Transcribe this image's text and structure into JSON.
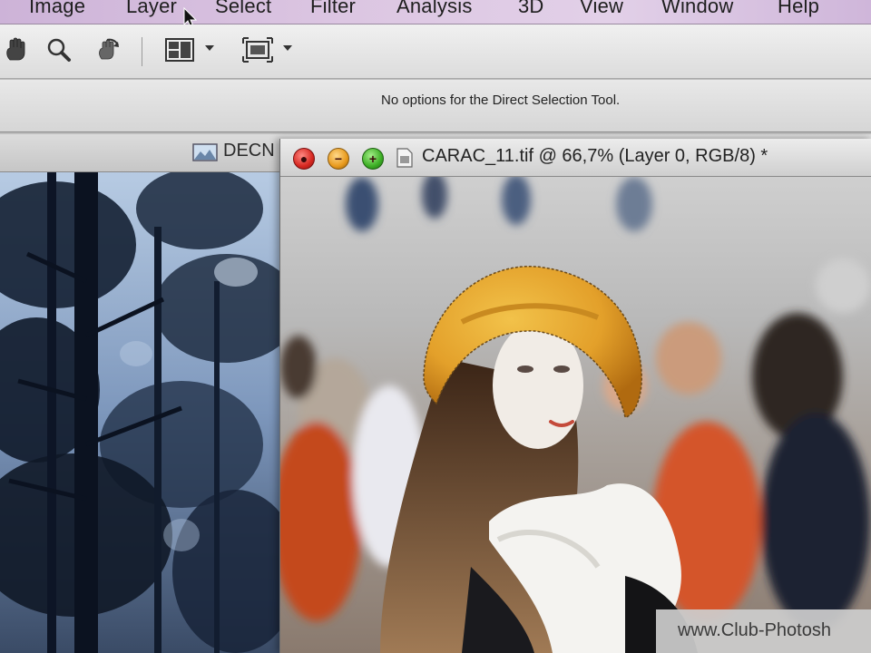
{
  "menu": {
    "items": [
      "Image",
      "Layer",
      "Select",
      "Filter",
      "Analysis",
      "3D",
      "View",
      "Window",
      "Help"
    ]
  },
  "toolbar": {
    "tools": [
      "hand-tool-icon",
      "zoom-tool-icon",
      "rotate-view-icon",
      "arrange-documents-icon",
      "screen-mode-icon"
    ]
  },
  "options_bar": {
    "message": "No options for the Direct Selection Tool."
  },
  "background_document": {
    "title": "DECN"
  },
  "front_document": {
    "title": "CARAC_11.tif @ 66,7% (Layer 0, RGB/8) *",
    "buttons": {
      "close": "close",
      "minimize": "minimize",
      "zoom": "+"
    }
  },
  "watermark": {
    "text": "www.Club-Photosh"
  },
  "colors": {
    "menubar": "#dcc6e2",
    "hat": "#e3a02a",
    "close": "#d62720",
    "minimize": "#e89a1d",
    "zoom": "#3cae24"
  }
}
